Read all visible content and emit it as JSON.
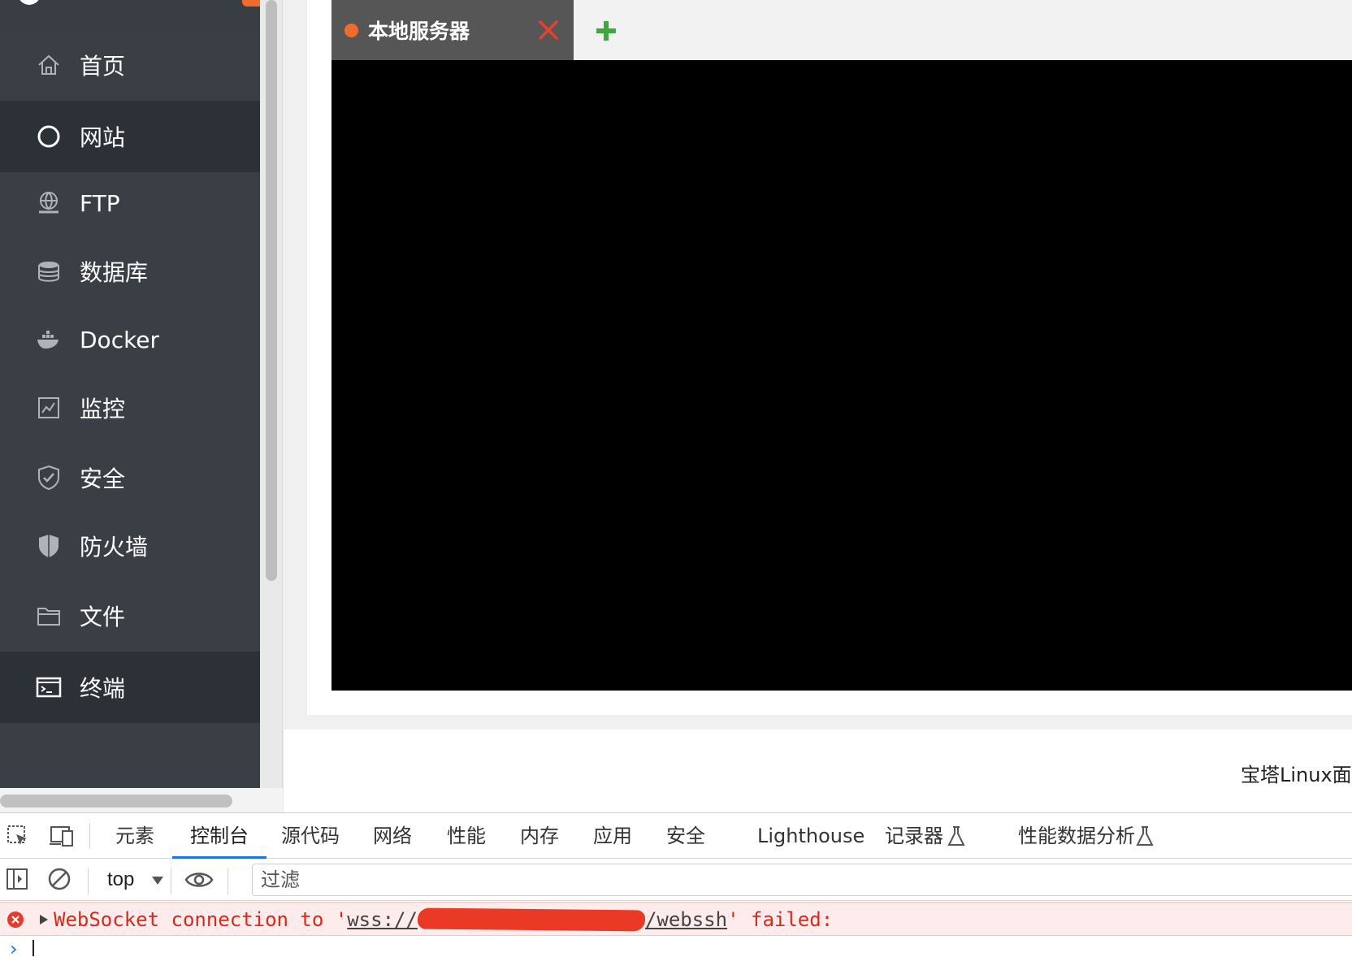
{
  "sidebar": {
    "items": [
      {
        "label": "首页",
        "icon": "home-icon"
      },
      {
        "label": "网站",
        "icon": "globe-circle-icon"
      },
      {
        "label": "FTP",
        "icon": "ftp-globe-icon"
      },
      {
        "label": "数据库",
        "icon": "database-icon"
      },
      {
        "label": "Docker",
        "icon": "docker-icon"
      },
      {
        "label": "监控",
        "icon": "monitor-chart-icon"
      },
      {
        "label": "安全",
        "icon": "shield-check-icon"
      },
      {
        "label": "防火墙",
        "icon": "firewall-shield-icon"
      },
      {
        "label": "文件",
        "icon": "folder-icon"
      },
      {
        "label": "终端",
        "icon": "terminal-icon"
      }
    ],
    "active_items": [
      "网站",
      "终端"
    ]
  },
  "terminal": {
    "tab_label": "本地服务器",
    "tab_status_color": "#f06b2c",
    "close_icon": "close-icon",
    "add_icon": "plus-icon"
  },
  "footer": {
    "text": "宝塔Linux面板"
  },
  "devtools": {
    "tabs": [
      "元素",
      "控制台",
      "源代码",
      "网络",
      "性能",
      "内存",
      "应用",
      "安全",
      "Lighthouse",
      "记录器",
      "性能数据分析"
    ],
    "active_tab": "控制台",
    "context": "top",
    "filter_placeholder": "过滤",
    "error": {
      "prefix": "WebSocket connection to '",
      "url_start": "wss://",
      "url_end": "/webssh",
      "suffix": "' failed:"
    },
    "colors": {
      "error": "#d52b1e",
      "accent": "#1a73e8"
    }
  }
}
